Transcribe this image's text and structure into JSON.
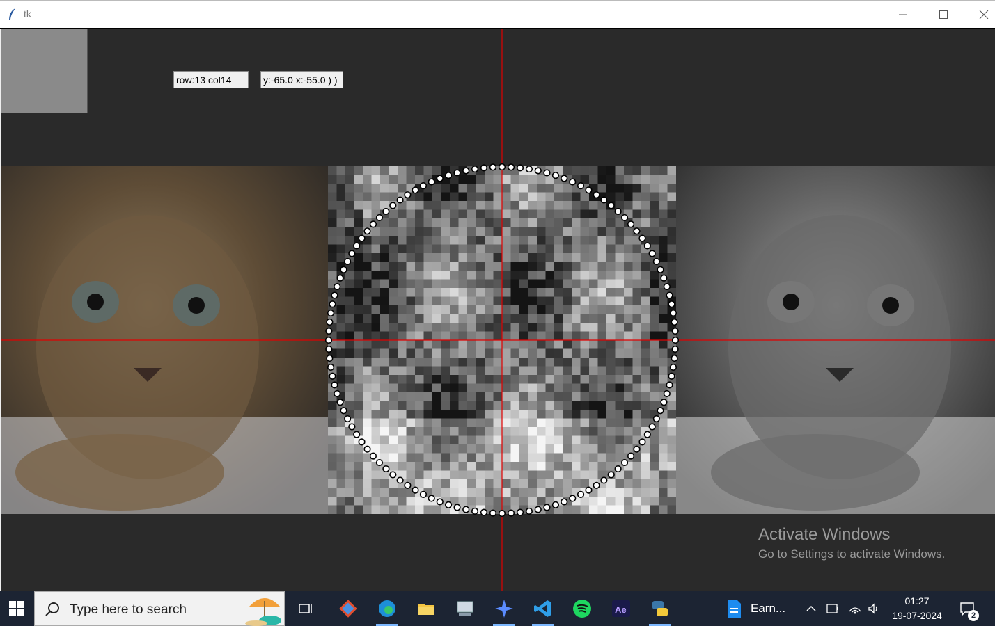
{
  "window": {
    "title": "tk"
  },
  "labels": {
    "rowcol": "row:13  col14",
    "yx": "y:-65.0  x:-55.0 ) )"
  },
  "watermark": {
    "title": "Activate Windows",
    "subtitle": "Go to Settings to activate Windows."
  },
  "taskbar": {
    "search_placeholder": "Type here to search",
    "apps": [
      "task-view",
      "git",
      "edge",
      "file-explorer",
      "remote-desktop",
      "copilot",
      "vscode",
      "spotify",
      "after-effects",
      "python"
    ],
    "pinned_doc_label": "Earn...",
    "time": "01:27",
    "date": "19-07-2024",
    "notification_count": "2"
  },
  "colors": {
    "crosshair": "#e00000",
    "canvas_bg": "#2a2a2a",
    "taskbar_bg": "#1c2433"
  }
}
